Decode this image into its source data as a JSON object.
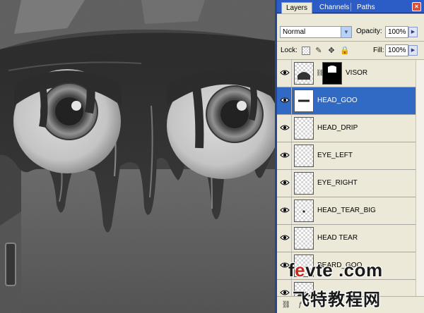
{
  "panel": {
    "tabs": [
      {
        "label": "Layers",
        "active": true
      },
      {
        "label": "Channels",
        "active": false
      },
      {
        "label": "Paths",
        "active": false
      }
    ],
    "close_glyph": "×",
    "blend_mode": "Normal",
    "opacity_label": "Opacity:",
    "opacity_value": "100%",
    "lock_label": "Lock:",
    "fill_label": "Fill:",
    "fill_value": "100%",
    "layers": [
      {
        "name": "VISOR",
        "selected": false,
        "has_mask": true
      },
      {
        "name": "HEAD_GOO",
        "selected": true,
        "has_mask": false
      },
      {
        "name": "HEAD_DRIP",
        "selected": false,
        "has_mask": false
      },
      {
        "name": "EYE_LEFT",
        "selected": false,
        "has_mask": false
      },
      {
        "name": "EYE_RIGHT",
        "selected": false,
        "has_mask": false
      },
      {
        "name": "HEAD_TEAR_BIG",
        "selected": false,
        "has_mask": false
      },
      {
        "name": "HEAD TEAR",
        "selected": false,
        "has_mask": false
      },
      {
        "name": "BEARD_GOO",
        "selected": false,
        "has_mask": false
      }
    ]
  },
  "watermark": {
    "site_prefix": "f",
    "site_e": "e",
    "site_rest": "vte .com",
    "chinese": "飞特教程网"
  },
  "colors": {
    "selected_row": "#316ac5",
    "panel_bg": "#ece9d8",
    "tab_bar": "#2c5cc5"
  },
  "icons": [
    "eye-icon",
    "chain-link-icon",
    "lock-transparent-icon",
    "lock-brush-icon",
    "lock-move-icon",
    "lock-all-icon",
    "panel-menu-icon",
    "close-icon",
    "dropdown-arrow-icon",
    "flyout-arrow-icon"
  ]
}
